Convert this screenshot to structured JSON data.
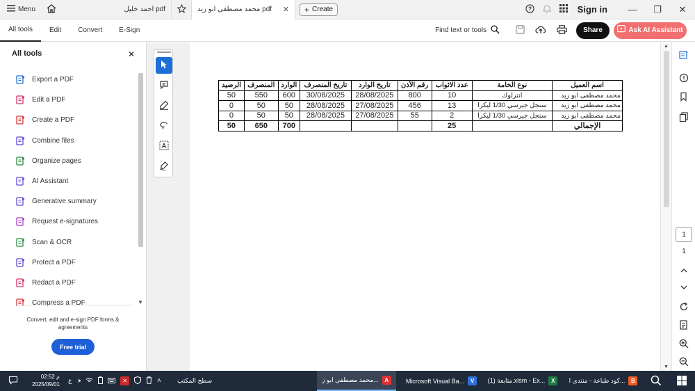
{
  "topbar": {
    "menu_label": "Menu",
    "tab_inactive": "احمد خليل pdf",
    "tab_active": "محمد مصطفى ابو زيد pdf",
    "create_label": "Create",
    "sign_in": "Sign in"
  },
  "toolbar": {
    "tabs": [
      "All tools",
      "Edit",
      "Convert",
      "E-Sign"
    ],
    "find_label": "Find text or tools",
    "share_label": "Share",
    "ai_label": "Ask AI Assistant"
  },
  "left_panel": {
    "title": "All tools",
    "items": [
      {
        "label": "Export a PDF",
        "icon": "export-pdf-icon",
        "color": "#1e6fd8"
      },
      {
        "label": "Edit a PDF",
        "icon": "edit-pdf-icon",
        "color": "#d6336c"
      },
      {
        "label": "Create a PDF",
        "icon": "create-pdf-icon",
        "color": "#e03131"
      },
      {
        "label": "Combine files",
        "icon": "combine-files-icon",
        "color": "#5b4bd6"
      },
      {
        "label": "Organize pages",
        "icon": "organize-pages-icon",
        "color": "#2b8a3e"
      },
      {
        "label": "AI Assistant",
        "icon": "ai-assistant-icon",
        "color": "#5b4bd6"
      },
      {
        "label": "Generative summary",
        "icon": "generative-summary-icon",
        "color": "#5b4bd6"
      },
      {
        "label": "Request e-signatures",
        "icon": "request-esignatures-icon",
        "color": "#ae3ec9"
      },
      {
        "label": "Scan & OCR",
        "icon": "scan-ocr-icon",
        "color": "#2b8a3e"
      },
      {
        "label": "Protect a PDF",
        "icon": "protect-pdf-icon",
        "color": "#5b4bd6"
      },
      {
        "label": "Redact a PDF",
        "icon": "redact-pdf-icon",
        "color": "#d6336c"
      },
      {
        "label": "Compress a PDF",
        "icon": "compress-pdf-icon",
        "color": "#e03131"
      }
    ],
    "footer_text": "Convert, edit and e-sign PDF forms & agreements",
    "free_trial": "Free trial"
  },
  "document": {
    "headers": [
      "اسم العميل",
      "نوع الخامة",
      "عدد الاثواب",
      "رقم الأذن",
      "تاريخ الوارد",
      "تاريخ المنصرف",
      "الوارد",
      "المنصرف",
      "الرصيد"
    ],
    "rows": [
      [
        "محمد مصطفى ابو زيد",
        "انترلوك",
        "10",
        "800",
        "28/08/2025",
        "30/08/2025",
        "600",
        "550",
        "50"
      ],
      [
        "محمد مصطفى ابو زيد",
        "سنجل جيرسي 1/30 ليكرا",
        "13",
        "456",
        "27/08/2025",
        "28/08/2025",
        "50",
        "50",
        "0"
      ],
      [
        "محمد مصطفى ابو زيد",
        "سنجل جيرسي 1/30 ليكرا",
        "2",
        "55",
        "27/08/2025",
        "28/08/2025",
        "50",
        "50",
        "0"
      ]
    ],
    "totals": [
      "الإجمالي",
      "",
      "25",
      "",
      "",
      "",
      "700",
      "650",
      "50"
    ]
  },
  "right_panel": {
    "page_current": "1",
    "page_total": "1"
  },
  "taskbar": {
    "time": "02:52 م",
    "date": "2025/09/01",
    "lang": "ع",
    "desktop_label": "سطح المكتب",
    "items": [
      {
        "label": "محمد مصطفى ابو ز...",
        "icon": "acrobat-icon",
        "color": "#e03131"
      },
      {
        "label": "Microsoft Visual Ba...",
        "icon": "vba-icon",
        "color": "#2f6fd8"
      },
      {
        "label": "متابعة (1).xlsm - Ex...",
        "icon": "excel-icon",
        "color": "#1e7a45"
      },
      {
        "label": "كود طباعة - منتدى ا...",
        "icon": "brave-icon",
        "color": "#f25a22"
      }
    ]
  }
}
